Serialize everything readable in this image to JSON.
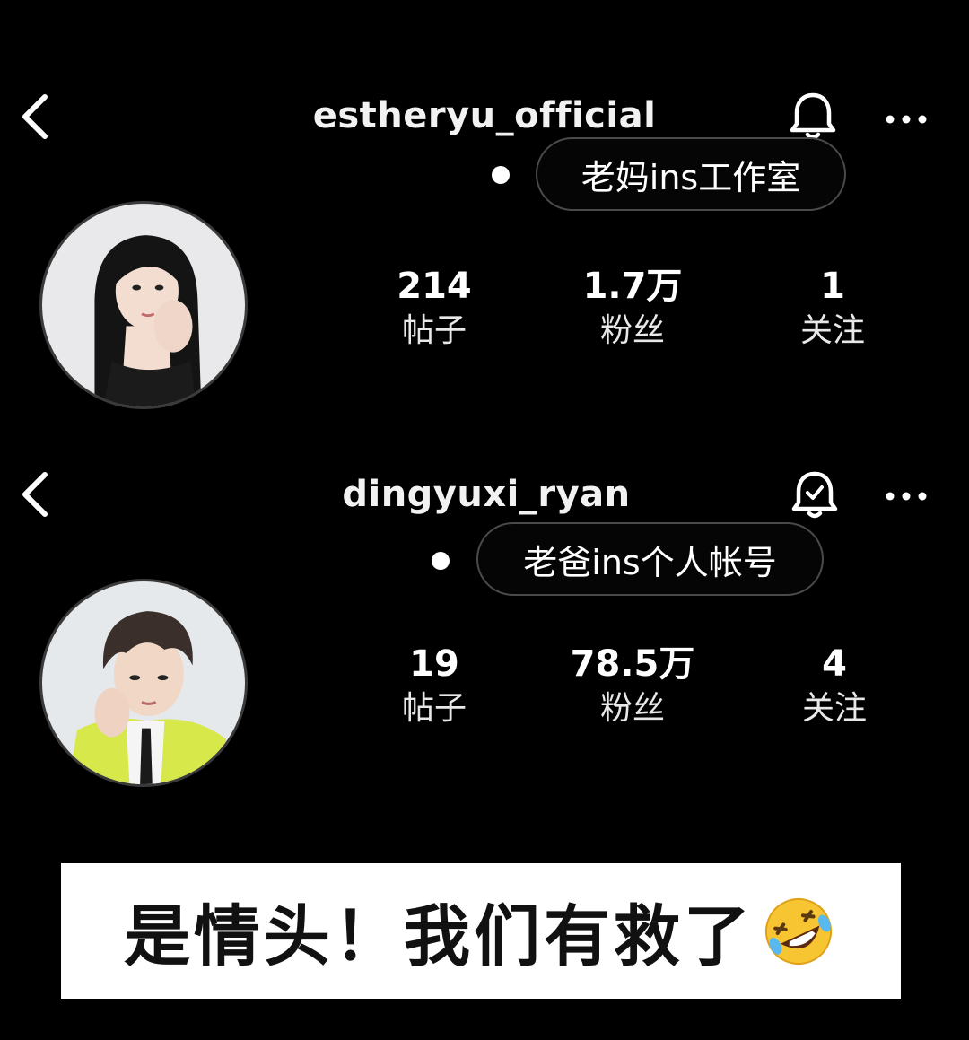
{
  "profiles": [
    {
      "username": "estheryu_official",
      "annotation": "老妈ins工作室",
      "stats": {
        "posts": {
          "value": "214",
          "label": "帖子"
        },
        "followers": {
          "value": "1.7万",
          "label": "粉丝"
        },
        "following": {
          "value": "1",
          "label": "关注"
        }
      },
      "bell_icon": "bell-icon"
    },
    {
      "username": "dingyuxi_ryan",
      "annotation": "老爸ins个人帐号",
      "stats": {
        "posts": {
          "value": "19",
          "label": "帖子"
        },
        "followers": {
          "value": "78.5万",
          "label": "粉丝"
        },
        "following": {
          "value": "4",
          "label": "关注"
        }
      },
      "bell_icon": "bell-check-icon"
    }
  ],
  "caption": {
    "text": "是情头！我们有救了",
    "emoji": "rolling-on-floor-laughing-emoji"
  },
  "colors": {
    "background": "#000000",
    "text": "#ffffff",
    "pill_border": "#4a4a4a",
    "caption_bg": "#ffffff",
    "caption_text": "#111111"
  }
}
